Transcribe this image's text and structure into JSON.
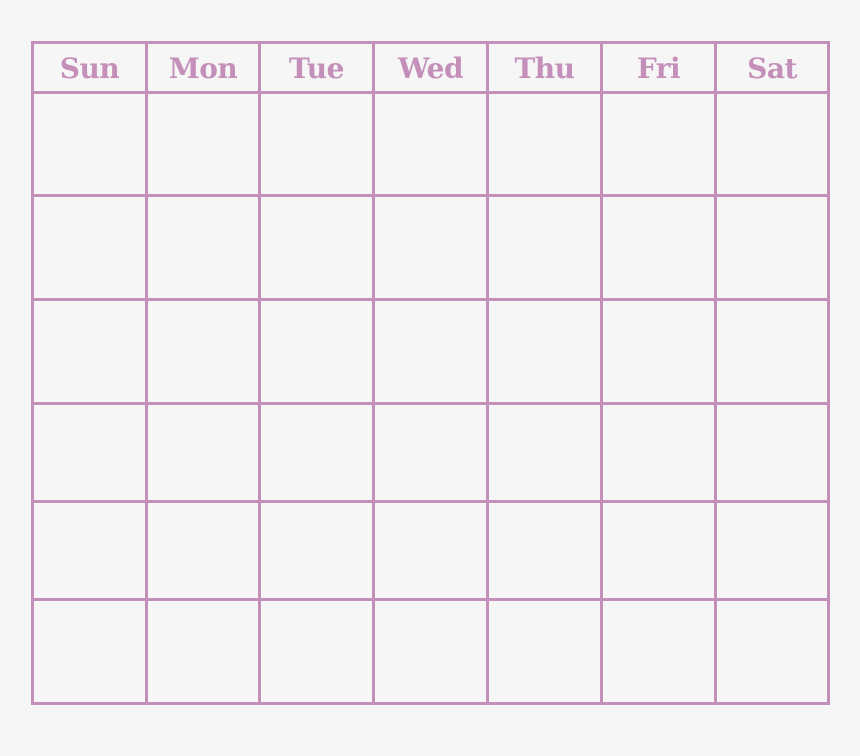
{
  "colors": {
    "grid": "#c48fb9",
    "background": "#f6f6f6"
  },
  "calendar": {
    "days": [
      "Sun",
      "Mon",
      "Tue",
      "Wed",
      "Thu",
      "Fri",
      "Sat"
    ],
    "week_rows": 6
  }
}
